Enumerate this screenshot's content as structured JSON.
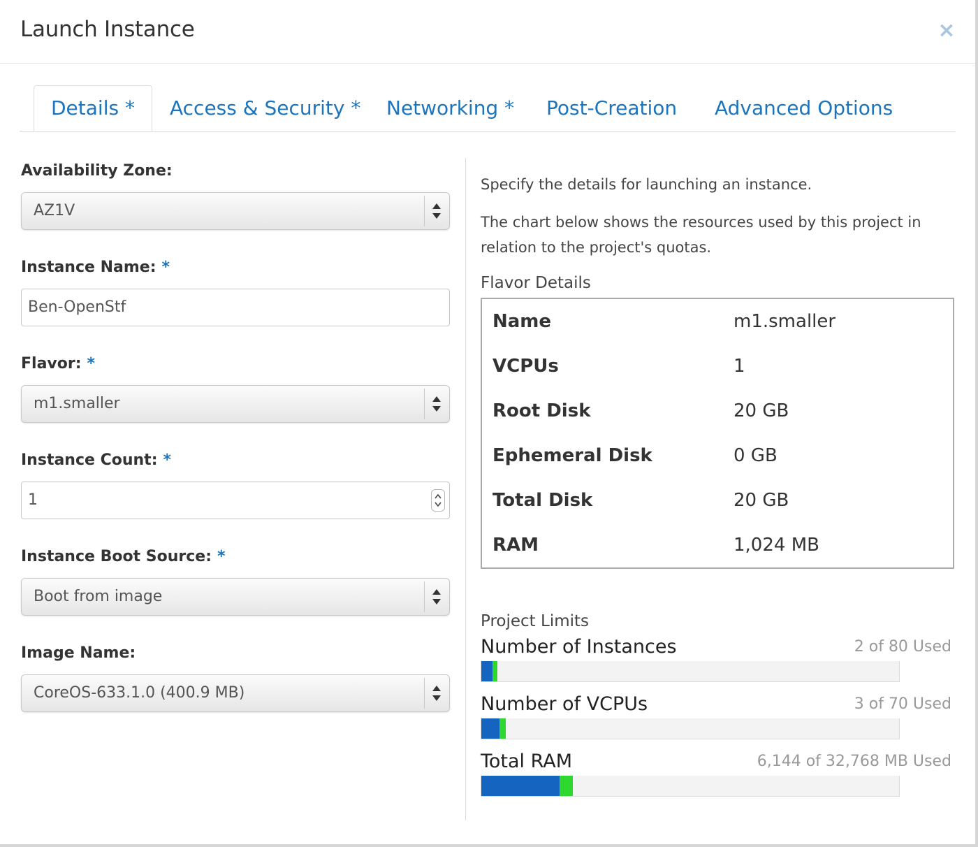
{
  "dialog": {
    "title": "Launch Instance",
    "close_label": "×"
  },
  "tabs": [
    {
      "label": "Details *",
      "active": true
    },
    {
      "label": "Access & Security *",
      "active": false
    },
    {
      "label": "Networking *",
      "active": false
    },
    {
      "label": "Post-Creation",
      "active": false
    },
    {
      "label": "Advanced Options",
      "active": false
    }
  ],
  "form": {
    "availability_zone": {
      "label": "Availability Zone:",
      "value": "AZ1V",
      "required": false
    },
    "instance_name": {
      "label": "Instance Name:",
      "value": "Ben-OpenStf",
      "required": true
    },
    "flavor": {
      "label": "Flavor:",
      "value": "m1.smaller",
      "required": true
    },
    "instance_count": {
      "label": "Instance Count:",
      "value": "1",
      "required": true
    },
    "boot_source": {
      "label": "Instance Boot Source:",
      "value": "Boot from image",
      "required": true
    },
    "image_name": {
      "label": "Image Name:",
      "value": "CoreOS-633.1.0 (400.9 MB)",
      "required": false
    },
    "required_marker": "*"
  },
  "help": {
    "line1": "Specify the details for launching an instance.",
    "line2": "The chart below shows the resources used by this project in relation to the project's quotas."
  },
  "flavor_details": {
    "title": "Flavor Details",
    "rows": [
      {
        "key": "Name",
        "value": "m1.smaller"
      },
      {
        "key": "VCPUs",
        "value": "1"
      },
      {
        "key": "Root Disk",
        "value": "20 GB"
      },
      {
        "key": "Ephemeral Disk",
        "value": "0 GB"
      },
      {
        "key": "Total Disk",
        "value": "20 GB"
      },
      {
        "key": "RAM",
        "value": "1,024 MB"
      }
    ]
  },
  "project_limits": {
    "title": "Project Limits",
    "items": [
      {
        "label": "Number of Instances",
        "used_text": "2 of 80 Used",
        "used": 2,
        "added": 1,
        "total": 80
      },
      {
        "label": "Number of VCPUs",
        "used_text": "3 of 70 Used",
        "used": 3,
        "added": 1,
        "total": 70
      },
      {
        "label": "Total RAM",
        "used_text": "6,144 of 32,768 MB Used",
        "used": 6144,
        "added": 1024,
        "total": 32768
      }
    ]
  },
  "colors": {
    "link": "#1c75bc",
    "bar_used": "#1565c0",
    "bar_added": "#2ed82e",
    "bar_bg": "#f3f3f3"
  }
}
